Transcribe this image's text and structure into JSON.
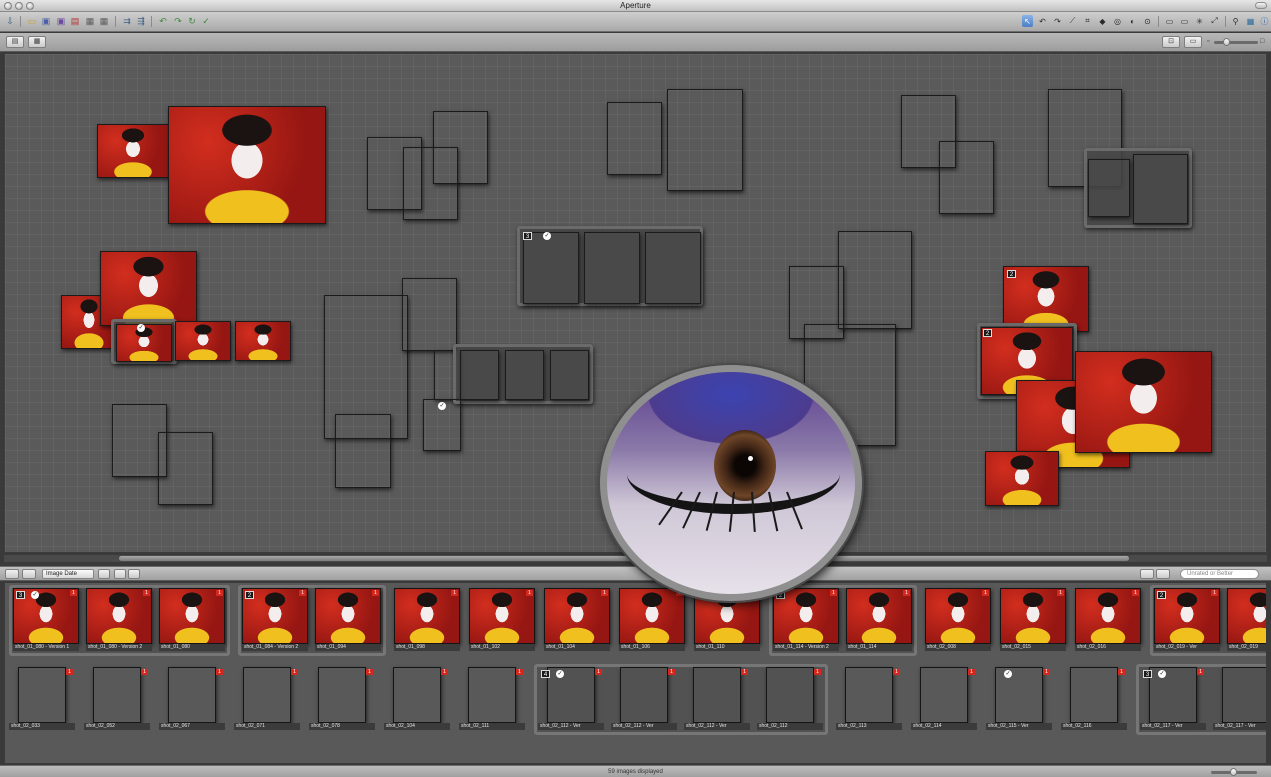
{
  "app": {
    "title": "Aperture"
  },
  "colors": {
    "accent": "#4b7fc6",
    "background": "#5a5a5a",
    "flag_red": "#d4281f"
  },
  "toolbar": {
    "left_icons": [
      "import-icon",
      "new-project-icon",
      "new-album-icon",
      "new-smart-album-icon",
      "new-light-table-icon",
      "new-book-icon",
      "stack-icon",
      "unstack-icon",
      "rotate-left-icon",
      "rotate-right-icon",
      "rotate-icon",
      "check-icon"
    ],
    "tools": [
      "select-tool",
      "rotate-left-tool",
      "rotate-right-tool",
      "straighten-tool",
      "crop-tool",
      "redeye-tool",
      "spot-patch-tool",
      "lift-stamp-tool",
      "loupe-tool"
    ],
    "view_buttons": [
      "browser-view-icon",
      "viewer-view-icon",
      "split-view-icon",
      "fullscreen-icon"
    ],
    "right_icons": [
      "loupe-icon",
      "adjustments-icon",
      "info-icon"
    ]
  },
  "browserbar": {
    "sort_label": "Image Date",
    "search_placeholder": "Unrated or Better"
  },
  "browser": {
    "row1": [
      {
        "group": "stack",
        "count": "3",
        "items": [
          {
            "label": "shot_01_080 - Version 1",
            "check": true
          },
          {
            "label": "shot_01_080 - Version 2"
          },
          {
            "label": "shot_01_080"
          }
        ]
      },
      {
        "group": "stack",
        "count": "2",
        "items": [
          {
            "label": "shot_01_084 - Version 2"
          },
          {
            "label": "shot_01_094"
          }
        ]
      },
      {
        "group": "single",
        "items": [
          {
            "label": "shot_01_098"
          }
        ]
      },
      {
        "group": "single",
        "items": [
          {
            "label": "shot_01_102"
          }
        ]
      },
      {
        "group": "single",
        "items": [
          {
            "label": "shot_01_104"
          }
        ]
      },
      {
        "group": "single",
        "items": [
          {
            "label": "shot_01_106"
          }
        ]
      },
      {
        "group": "single",
        "items": [
          {
            "label": "shot_01_110"
          }
        ]
      },
      {
        "group": "stack",
        "count": "2",
        "items": [
          {
            "label": "shot_01_114 - Version 2"
          },
          {
            "label": "shot_01_114"
          }
        ]
      },
      {
        "group": "single",
        "items": [
          {
            "label": "shot_02_008"
          }
        ]
      },
      {
        "group": "single",
        "items": [
          {
            "label": "shot_02_015"
          }
        ]
      },
      {
        "group": "single",
        "items": [
          {
            "label": "shot_02_016"
          }
        ]
      },
      {
        "group": "stack",
        "count": "2",
        "items": [
          {
            "label": "shot_02_019 - Ver"
          },
          {
            "label": "shot_02_019"
          }
        ]
      }
    ],
    "row2": [
      {
        "group": "single",
        "items": [
          {
            "label": "shot_02_033"
          }
        ]
      },
      {
        "group": "single",
        "items": [
          {
            "label": "shot_02_052"
          }
        ]
      },
      {
        "group": "single",
        "items": [
          {
            "label": "shot_02_067"
          }
        ]
      },
      {
        "group": "single",
        "items": [
          {
            "label": "shot_02_071"
          }
        ]
      },
      {
        "group": "single",
        "items": [
          {
            "label": "shot_02_078"
          }
        ]
      },
      {
        "group": "single",
        "items": [
          {
            "label": "shot_02_104"
          }
        ]
      },
      {
        "group": "single",
        "items": [
          {
            "label": "shot_02_111"
          }
        ]
      },
      {
        "group": "stack",
        "count": "4",
        "items": [
          {
            "label": "shot_02_112 - Ver",
            "check": true
          },
          {
            "label": "shot_02_112 - Ver"
          },
          {
            "label": "shot_02_112 - Ver"
          },
          {
            "label": "shot_02_112"
          }
        ]
      },
      {
        "group": "single",
        "items": [
          {
            "label": "shot_02_113"
          }
        ]
      },
      {
        "group": "single",
        "items": [
          {
            "label": "shot_02_114"
          }
        ]
      },
      {
        "group": "single",
        "items": [
          {
            "label": "shot_02_115 - Ver",
            "check": true
          }
        ]
      },
      {
        "group": "single",
        "items": [
          {
            "label": "shot_02_116"
          }
        ]
      },
      {
        "group": "stack",
        "count": "3",
        "items": [
          {
            "label": "shot_02_117 - Ver",
            "check": true
          },
          {
            "label": "shot_02_117 - Ver"
          },
          {
            "label": "shot_02_117"
          }
        ]
      }
    ]
  },
  "status": {
    "text": "59 images displayed"
  }
}
